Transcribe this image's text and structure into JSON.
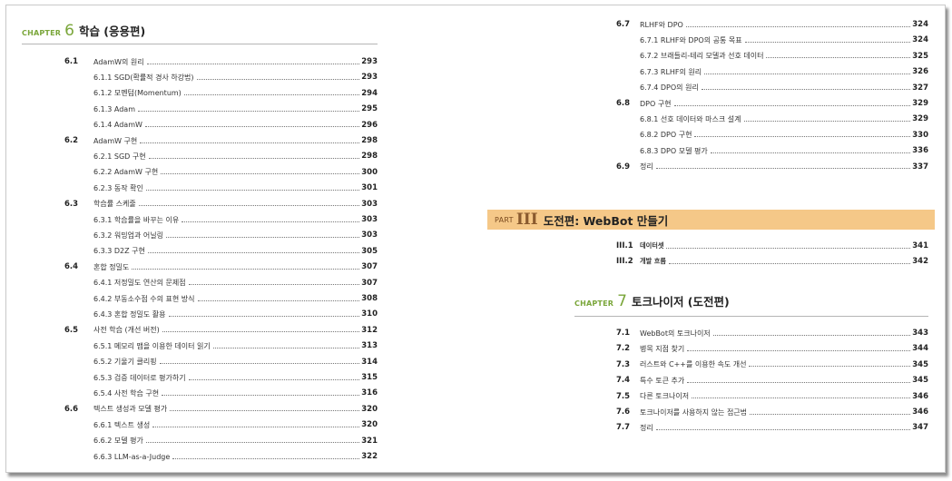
{
  "left": {
    "chapter_word": "CHAPTER",
    "chapter_number": "6",
    "chapter_title": "학습 (응용편)",
    "entries": [
      {
        "num": "6.1",
        "label": "AdamW의 원리",
        "page": "293",
        "level": 1
      },
      {
        "num": "",
        "label": "6.1.1 SGD(확률적 경사 하강법)",
        "page": "293",
        "level": 2
      },
      {
        "num": "",
        "label": "6.1.2 모멘텀(Momentum)",
        "page": "294",
        "level": 2
      },
      {
        "num": "",
        "label": "6.1.3 Adam",
        "page": "295",
        "level": 2
      },
      {
        "num": "",
        "label": "6.1.4 AdamW",
        "page": "296",
        "level": 2
      },
      {
        "num": "6.2",
        "label": "AdamW 구현",
        "page": "298",
        "level": 1
      },
      {
        "num": "",
        "label": "6.2.1 SGD 구현",
        "page": "298",
        "level": 2
      },
      {
        "num": "",
        "label": "6.2.2 AdamW 구현",
        "page": "300",
        "level": 2
      },
      {
        "num": "",
        "label": "6.2.3 동작 확인",
        "page": "301",
        "level": 2
      },
      {
        "num": "6.3",
        "label": "학습률 스케줄",
        "page": "303",
        "level": 1
      },
      {
        "num": "",
        "label": "6.3.1 학습률을 바꾸는 이유",
        "page": "303",
        "level": 2
      },
      {
        "num": "",
        "label": "6.3.2 워밍업과 어닐링",
        "page": "303",
        "level": 2
      },
      {
        "num": "",
        "label": "6.3.3 D2Z 구현",
        "page": "305",
        "level": 2
      },
      {
        "num": "6.4",
        "label": "혼합 정밀도",
        "page": "307",
        "level": 1
      },
      {
        "num": "",
        "label": "6.4.1 저정밀도 연산의 문제점",
        "page": "307",
        "level": 2
      },
      {
        "num": "",
        "label": "6.4.2 부동소수점 수의 표현 방식",
        "page": "308",
        "level": 2
      },
      {
        "num": "",
        "label": "6.4.3 혼합 정밀도 활용",
        "page": "310",
        "level": 2
      },
      {
        "num": "6.5",
        "label": "사전 학습 (개선 버전)",
        "page": "312",
        "level": 1
      },
      {
        "num": "",
        "label": "6.5.1 메모리 맵을 이용한 데이터 읽기",
        "page": "313",
        "level": 2
      },
      {
        "num": "",
        "label": "6.5.2 기울기 클리핑",
        "page": "314",
        "level": 2
      },
      {
        "num": "",
        "label": "6.5.3 검증 데이터로 평가하기",
        "page": "315",
        "level": 2
      },
      {
        "num": "",
        "label": "6.5.4 사전 학습 구현",
        "page": "316",
        "level": 2
      },
      {
        "num": "6.6",
        "label": "텍스트 생성과 모델 평가",
        "page": "320",
        "level": 1
      },
      {
        "num": "",
        "label": "6.6.1 텍스트 생성",
        "page": "320",
        "level": 2
      },
      {
        "num": "",
        "label": "6.6.2 모델 평가",
        "page": "321",
        "level": 2
      },
      {
        "num": "",
        "label": "6.6.3 LLM-as-a-Judge",
        "page": "322",
        "level": 2
      }
    ]
  },
  "right": {
    "entries_top": [
      {
        "num": "6.7",
        "label": "RLHF와 DPO",
        "page": "324",
        "level": 1
      },
      {
        "num": "",
        "label": "6.7.1 RLHF와 DPO의 공통 목표",
        "page": "324",
        "level": 2
      },
      {
        "num": "",
        "label": "6.7.2 브래들리-테리 모델과 선호 데이터",
        "page": "325",
        "level": 2
      },
      {
        "num": "",
        "label": "6.7.3 RLHF의 원리",
        "page": "326",
        "level": 2
      },
      {
        "num": "",
        "label": "6.7.4 DPO의 원리",
        "page": "327",
        "level": 2
      },
      {
        "num": "6.8",
        "label": "DPO 구현",
        "page": "329",
        "level": 1
      },
      {
        "num": "",
        "label": "6.8.1 선호 데이터와 마스크 설계",
        "page": "329",
        "level": 2
      },
      {
        "num": "",
        "label": "6.8.2 DPO 구현",
        "page": "330",
        "level": 2
      },
      {
        "num": "",
        "label": "6.8.3 DPO 모델 평가",
        "page": "336",
        "level": 2
      },
      {
        "num": "6.9",
        "label": "정리",
        "page": "337",
        "level": 1
      }
    ],
    "part_word": "PART",
    "part_number": "III",
    "part_title": "도전편: WebBot 만들기",
    "part_entries": [
      {
        "num": "III.1",
        "label": "데이터셋",
        "page": "341"
      },
      {
        "num": "III.2",
        "label": "개발 흐름",
        "page": "342"
      }
    ],
    "chapter_word": "CHAPTER",
    "chapter_number": "7",
    "chapter_title": "토크나이저 (도전편)",
    "entries_ch7": [
      {
        "num": "7.1",
        "label": "WebBot의 토크나이저",
        "page": "343",
        "level": 1
      },
      {
        "num": "7.2",
        "label": "병목 지점 찾기",
        "page": "344",
        "level": 1
      },
      {
        "num": "7.3",
        "label": "러스트와 C++를 이용한 속도 개선",
        "page": "345",
        "level": 1
      },
      {
        "num": "7.4",
        "label": "특수 토큰 추가",
        "page": "345",
        "level": 1
      },
      {
        "num": "7.5",
        "label": "다른 토크나이저",
        "page": "346",
        "level": 1
      },
      {
        "num": "7.6",
        "label": "토크나이저를 사용하지 않는 접근법",
        "page": "346",
        "level": 1
      },
      {
        "num": "7.7",
        "label": "정리",
        "page": "347",
        "level": 1
      }
    ]
  }
}
